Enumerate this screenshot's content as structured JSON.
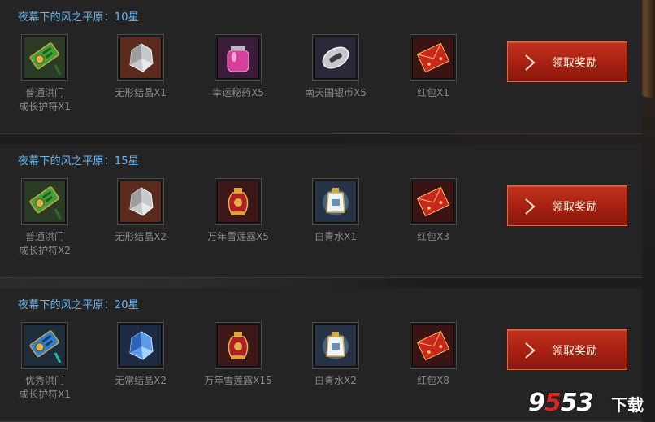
{
  "sections": [
    {
      "title": "夜幕下的风之平原：10星",
      "button_label": "领取奖励",
      "items": [
        {
          "icon": "talisman-green-icon",
          "label_line1": "普通洪门",
          "label_line2": "成长护符X1"
        },
        {
          "icon": "crystal-silver-icon",
          "label_line1": "无形结晶X1",
          "label_line2": ""
        },
        {
          "icon": "potion-jar-pink-icon",
          "label_line1": "幸运秘药X5",
          "label_line2": ""
        },
        {
          "icon": "silver-coin-icon",
          "label_line1": "南天国银币X5",
          "label_line2": ""
        },
        {
          "icon": "red-envelope-icon",
          "label_line1": "红包X1",
          "label_line2": ""
        }
      ]
    },
    {
      "title": "夜幕下的风之平原：15星",
      "button_label": "领取奖励",
      "items": [
        {
          "icon": "talisman-green-icon",
          "label_line1": "普通洪门",
          "label_line2": "成长护符X2"
        },
        {
          "icon": "crystal-silver-icon",
          "label_line1": "无形结晶X2",
          "label_line2": ""
        },
        {
          "icon": "vase-red-gold-icon",
          "label_line1": "万年雪莲露X5",
          "label_line2": ""
        },
        {
          "icon": "bottle-white-blue-icon",
          "label_line1": "白青水X1",
          "label_line2": ""
        },
        {
          "icon": "red-envelope-icon",
          "label_line1": "红包X3",
          "label_line2": ""
        }
      ]
    },
    {
      "title": "夜幕下的风之平原：20星",
      "button_label": "领取奖励",
      "items": [
        {
          "icon": "talisman-blue-icon",
          "label_line1": "优秀洪门",
          "label_line2": "成长护符X1"
        },
        {
          "icon": "crystal-blue-icon",
          "label_line1": "无常结晶X2",
          "label_line2": ""
        },
        {
          "icon": "vase-red-gold-icon",
          "label_line1": "万年雪莲露X15",
          "label_line2": ""
        },
        {
          "icon": "bottle-white-blue-icon",
          "label_line1": "白青水X2",
          "label_line2": ""
        },
        {
          "icon": "red-envelope-icon",
          "label_line1": "红包X8",
          "label_line2": ""
        }
      ]
    }
  ],
  "watermark": {
    "digits_white": "9",
    "digits_red": "5",
    "digits_rest": "53",
    "suffix": "下载"
  },
  "colors": {
    "title": "#6bb7f0",
    "label": "#8a8a8a",
    "button": "#b0241a",
    "background": "#1d1d1f"
  }
}
